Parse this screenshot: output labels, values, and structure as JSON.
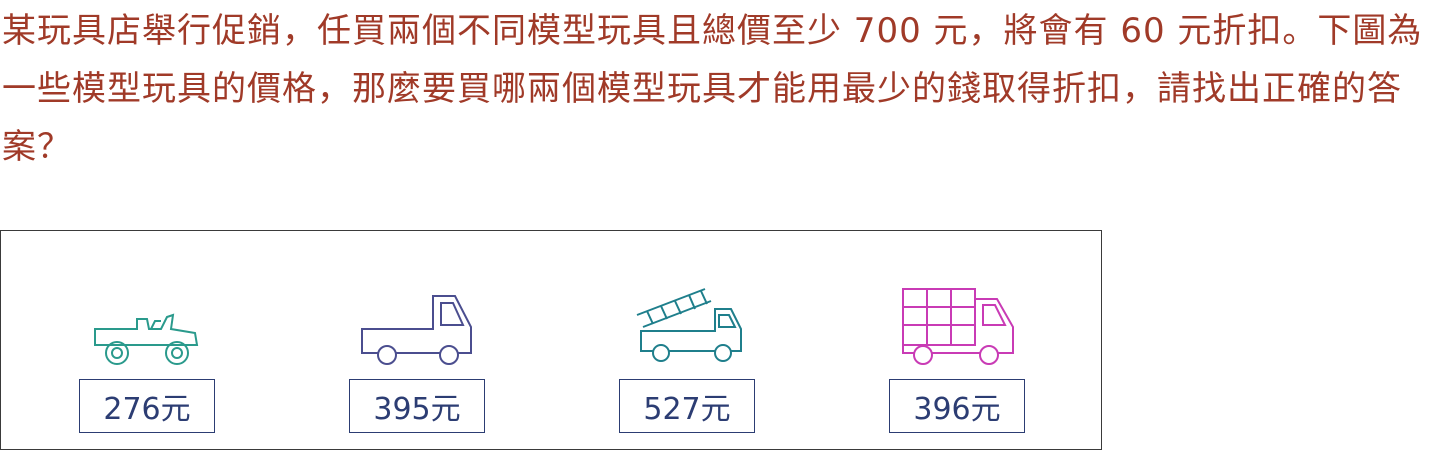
{
  "question": {
    "text": "某玩具店舉行促銷，任買兩個不同模型玩具且總價至少 700 元，將會有 60 元折扣。下圖為一些模型玩具的價格，那麼要買哪兩個模型玩具才能用最少的錢取得折扣，請找出正確的答案？"
  },
  "toys": [
    {
      "name": "jeep",
      "icon": "jeep-icon",
      "price": "276元",
      "color": "#2a9a8c"
    },
    {
      "name": "pickup-truck",
      "icon": "pickup-truck-icon",
      "price": "395元",
      "color": "#4b4e8f"
    },
    {
      "name": "ladder-truck",
      "icon": "ladder-truck-icon",
      "price": "527元",
      "color": "#1f7f8c"
    },
    {
      "name": "box-truck",
      "icon": "box-truck-icon",
      "price": "396元",
      "color": "#c93bb5"
    }
  ]
}
